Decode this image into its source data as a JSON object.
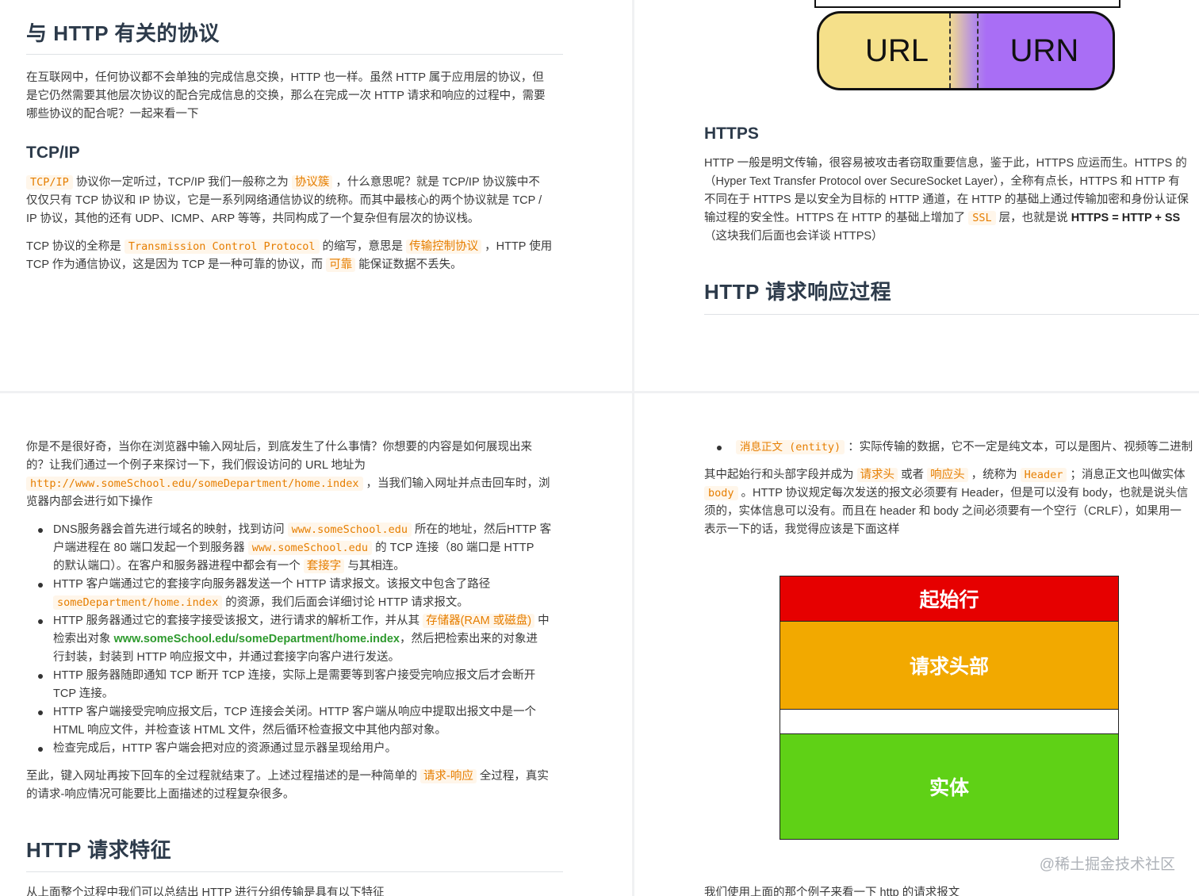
{
  "p1": {
    "title": "与 HTTP 有关的协议",
    "intro": [
      "在互联网中，任何协议都不会单独的完成信息交换，HTTP 也一样。虽然 HTTP 属于应用层的协议，但",
      "是它仍然需要其他层次协议的配合完成信息的交换，那么在完成一次 HTTP 请求和响应的过程中，需要",
      "哪些协议的配合呢？一起来看一下"
    ],
    "tcpip_heading": "TCP/IP",
    "para1": {
      "code1": "TCP/IP",
      "t1": "协议你一定听过，TCP/IP 我们一般称之为",
      "kw1": "协议簇",
      "t2": "，什么意思呢？就是 TCP/IP 协议簇中不",
      "l2": "仅仅只有 TCP 协议和 IP 协议，它是一系列网络通信协议的统称。而其中最核心的两个协议就是 TCP /",
      "l3": "IP 协议，其他的还有 UDP、ICMP、ARP 等等，共同构成了一个复杂但有层次的协议栈。"
    },
    "para2": {
      "t1": "TCP 协议的全称是",
      "code1": "Transmission Control Protocol",
      "t2": "的缩写，意思是",
      "kw1": "传输控制协议",
      "t3": "，HTTP 使用",
      "t4": "TCP 作为通信协议，这是因为 TCP 是一种可靠的协议，而",
      "kw2": "可靠",
      "t5": "能保证数据不丢失。"
    }
  },
  "p2": {
    "url_label": "URL",
    "urn_label": "URN",
    "https_heading": "HTTPS",
    "https_l1": "HTTP 一般是明文传输，很容易被攻击者窃取重要信息，鉴于此，HTTPS 应运而生。HTTPS 的",
    "https_l2": "（Hyper Text Transfer Protocol over SecureSocket Layer），全称有点长，HTTPS 和 HTTP 有",
    "https_l3": "不同在于 HTTPS 是以安全为目标的 HTTP 通道，在 HTTP 的基础上通过传输加密和身份认证保",
    "https_l4a": "输过程的安全性。HTTPS 在 HTTP 的基础上增加了",
    "https_ssl": "SSL",
    "https_l4b": "层，也就是说",
    "https_bold": "HTTPS = HTTP + SS",
    "https_l5": "（这块我们后面也会详谈 HTTPS）",
    "process_heading": "HTTP 请求响应过程"
  },
  "p3": {
    "intro_l1": "你是不是很好奇，当你在浏览器中输入网址后，到底发生了什么事情？你想要的内容是如何展现出来",
    "intro_l2": "的？让我们通过一个例子来探讨一下，我们假设访问的 URL 地址为",
    "url_code": "http://www.someSchool.edu/someDepartment/home.index",
    "intro_l3b": "，当我们输入网址并点击回车时，浏",
    "intro_l4": "览器内部会进行如下操作",
    "b1_l1a": "DNS服务器会首先进行域名的映射，找到访问",
    "b1_code1": "www.someSchool.edu",
    "b1_l1b": "所在的地址，然后HTTP 客",
    "b1_l2a": "户端进程在 80 端口发起一个到服务器",
    "b1_code2": "www.someSchool.edu",
    "b1_l2b": "的 TCP 连接（80 端口是 HTTP",
    "b1_l3a": "的默认端口）。在客户和服务器进程中都会有一个",
    "b1_kw": "套接字",
    "b1_l3b": "与其相连。",
    "b2_l1": "HTTP 客户端通过它的套接字向服务器发送一个 HTTP 请求报文。该报文中包含了路径",
    "b2_code": "someDepartment/home.index",
    "b2_l2b": "的资源，我们后面会详细讨论 HTTP 请求报文。",
    "b3_l1a": "HTTP 服务器通过它的套接字接受该报文，进行请求的解析工作，并从其",
    "b3_kw": "存储器(RAM 或磁盘)",
    "b3_l1b": "中",
    "b3_l2a": "检索出对象",
    "b3_green": "www.someSchool.edu/someDepartment/home.index",
    "b3_l2b": "，然后把检索出来的对象进",
    "b3_l3": "行封装，封装到 HTTP 响应报文中，并通过套接字向客户进行发送。",
    "b4_l1": "HTTP 服务器随即通知 TCP 断开 TCP 连接，实际上是需要等到客户接受完响应报文后才会断开",
    "b4_l2": "TCP 连接。",
    "b5_l1": "HTTP 客户端接受完响应报文后，TCP 连接会关闭。HTTP 客户端从响应中提取出报文中是一个",
    "b5_l2": "HTML 响应文件，并检查该 HTML 文件，然后循环检查报文中其他内部对象。",
    "b6_l1": "检查完成后，HTTP 客户端会把对应的资源通过显示器呈现给用户。",
    "end_l1a": "至此，键入网址再按下回车的全过程就结束了。上述过程描述的是一种简单的",
    "end_kw": "请求-响应",
    "end_l1b": "全过程，真实",
    "end_l2": "的请求-响应情况可能要比上面描述的过程复杂很多。",
    "features_heading": "HTTP 请求特征",
    "features_line": "从上面整个过程中我们可以总结出 HTTP 进行分组传输是具有以下特征"
  },
  "p4": {
    "bullet_kw": "消息正文 (entity)",
    "bullet_text": "：实际传输的数据，它不一定是纯文本，可以是图片、视频等二进制",
    "l1a": "其中起始行和头部字段并成为",
    "kw1": "请求头",
    "l1b": "或者",
    "kw2": "响应头",
    "l1c": "，统称为",
    "code1": "Header",
    "l1d": "；消息正文也叫做实体",
    "code2": "body",
    "l2b": "。HTTP 协议规定每次发送的报文必须要有 Header，但是可以没有 body，也就是说头信",
    "l3": "须的，实体信息可以没有。而且在 header 和 body 之间必须要有一个空行（CRLF），如果用一",
    "l4": "表示一下的话，我觉得应该是下面这样",
    "blk_start": "起始行",
    "blk_header": "请求头部",
    "blk_entity": "实体",
    "colors": {
      "start": "#e60000",
      "header": "#f2a900",
      "entity": "#5fd116"
    },
    "watermark": "@稀土掘金技术社区",
    "bottom_line": "我们使用上面的那个例子来看一下 http 的请求报文"
  }
}
